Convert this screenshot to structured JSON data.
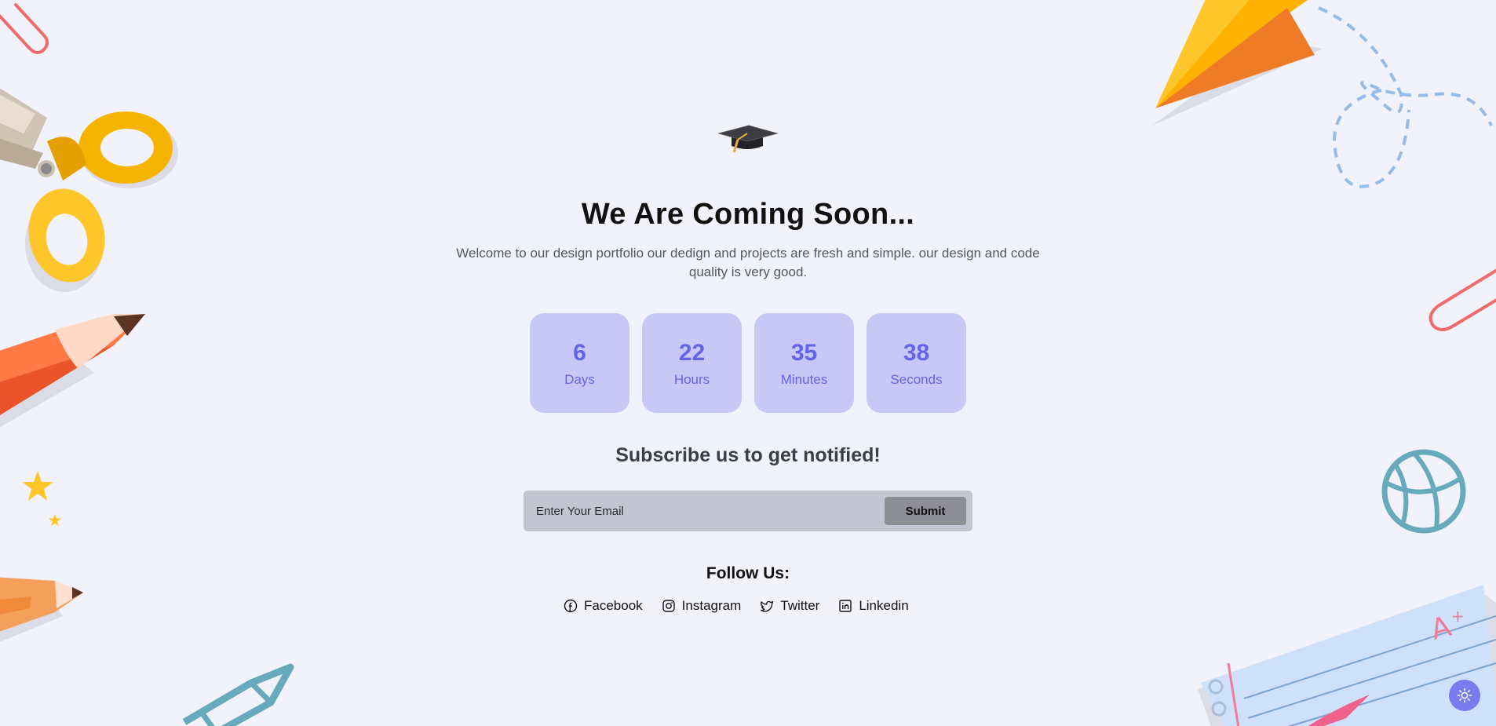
{
  "hero": {
    "title": "We Are Coming Soon...",
    "description": "Welcome to our design portfolio our dedign and projects are fresh and simple. our design and code quality is very good.",
    "icon": "graduation-cap-icon"
  },
  "countdown": [
    {
      "value": "6",
      "label": "Days"
    },
    {
      "value": "22",
      "label": "Hours"
    },
    {
      "value": "35",
      "label": "Minutes"
    },
    {
      "value": "38",
      "label": "Seconds"
    }
  ],
  "subscribe": {
    "title": "Subscribe us to get notified!",
    "placeholder": "Enter Your Email",
    "submit_label": "Submit"
  },
  "follow": {
    "title": "Follow Us:",
    "links": [
      {
        "label": "Facebook",
        "icon": "facebook-icon"
      },
      {
        "label": "Instagram",
        "icon": "instagram-icon"
      },
      {
        "label": "Twitter",
        "icon": "twitter-icon"
      },
      {
        "label": "Linkedin",
        "icon": "linkedin-icon"
      }
    ]
  },
  "theme_toggle": {
    "icon": "sun-icon"
  },
  "colors": {
    "background": "#f2f2fc",
    "accent": "#6464e8",
    "box": "#c8c8f6"
  }
}
